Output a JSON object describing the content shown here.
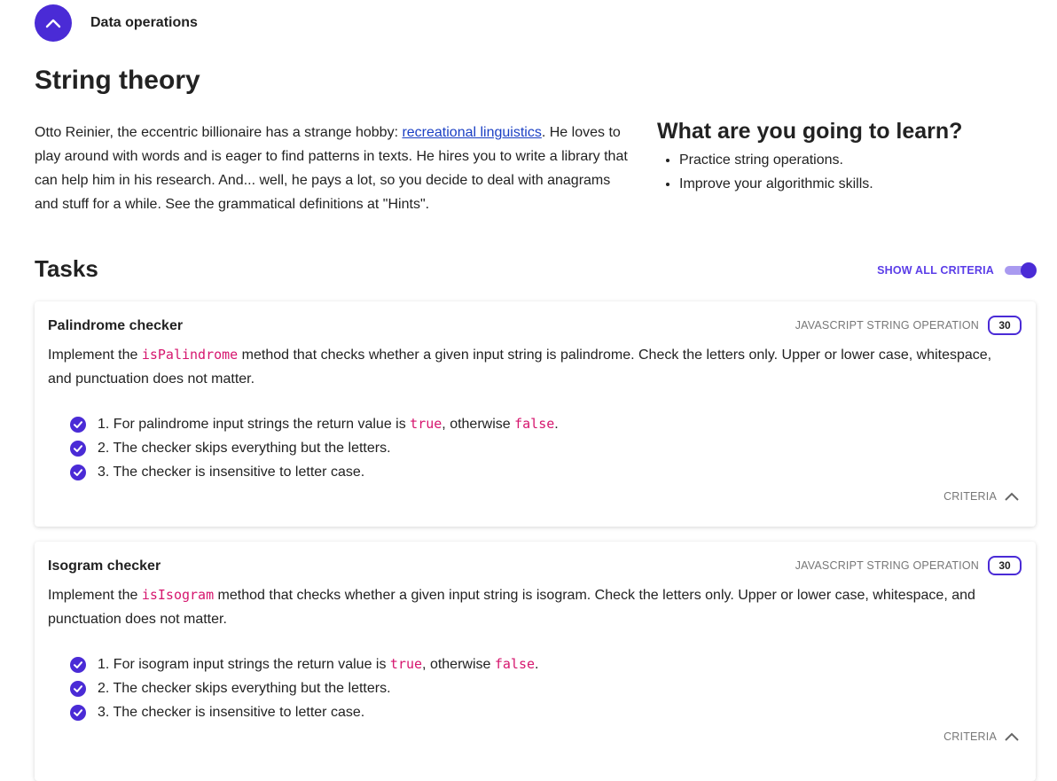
{
  "breadcrumb": {
    "label": "Data operations"
  },
  "page": {
    "title": "String theory",
    "intro_before_link": "Otto Reinier, the eccentric billionaire has a strange hobby: ",
    "intro_link": "recreational linguistics",
    "intro_after_link": ". He loves to play around with words and is eager to find patterns in texts. He hires you to write a library that can help him in his research. And... well, he pays a lot, so you decide to deal with anagrams and stuff for a while. See the grammatical definitions at \"Hints\"."
  },
  "learn": {
    "title": "What are you going to learn?",
    "items": [
      "Practice string operations.",
      "Improve your algorithmic skills."
    ]
  },
  "tasks": {
    "title": "Tasks",
    "show_all_label": "SHOW ALL CRITERIA",
    "show_all_on": true,
    "cards": [
      {
        "title": "Palindrome checker",
        "category": "JAVASCRIPT STRING OPERATION",
        "points": "30",
        "desc_before": "Implement the ",
        "method": "isPalindrome",
        "desc_after": " method that checks whether a given input string is palindrome. Check the letters only. Upper or lower case, whitespace, and punctuation does not matter.",
        "criteria": [
          {
            "prefix": "1. For palindrome input strings the return value is ",
            "code1": "true",
            "middle": ", otherwise ",
            "code2": "false",
            "suffix": "."
          },
          {
            "prefix": "2. The checker skips everything but the letters."
          },
          {
            "prefix": "3. The checker is insensitive to letter case."
          }
        ],
        "criteria_label": "CRITERIA"
      },
      {
        "title": "Isogram checker",
        "category": "JAVASCRIPT STRING OPERATION",
        "points": "30",
        "desc_before": "Implement the ",
        "method": "isIsogram",
        "desc_after": " method that checks whether a given input string is isogram. Check the letters only. Upper or lower case, whitespace, and punctuation does not matter.",
        "criteria": [
          {
            "prefix": "1. For isogram input strings the return value is ",
            "code1": "true",
            "middle": ", otherwise ",
            "code2": "false",
            "suffix": "."
          },
          {
            "prefix": "2. The checker skips everything but the letters."
          },
          {
            "prefix": "3. The checker is insensitive to letter case."
          }
        ],
        "criteria_label": "CRITERIA"
      }
    ]
  },
  "colors": {
    "accent": "#4a2bd6",
    "code": "#d6166e",
    "link": "#1a3fc4",
    "muted": "#777777"
  },
  "icons": {
    "collapse": "chevron-up-icon",
    "criteria_done": "check-circle-icon",
    "criteria_toggle": "chevron-up-icon"
  }
}
